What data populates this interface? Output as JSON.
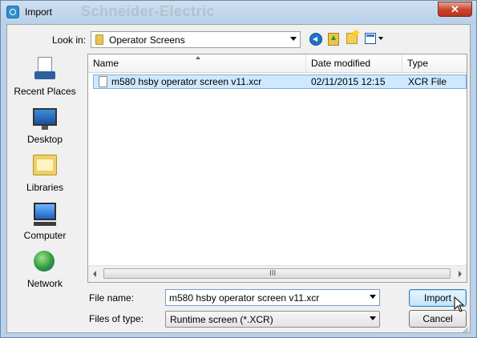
{
  "window": {
    "title": "Import",
    "watermark": "Schneider-Electric",
    "close_symbol": "✕"
  },
  "toolbar": {
    "look_in_label": "Look in:",
    "look_in_value": "Operator Screens",
    "icons": [
      "back-arrow-icon",
      "up-folder-icon",
      "new-folder-icon",
      "view-menu-icon"
    ]
  },
  "places": [
    {
      "label": "Recent Places",
      "icon": "recent-places-icon"
    },
    {
      "label": "Desktop",
      "icon": "desktop-icon"
    },
    {
      "label": "Libraries",
      "icon": "libraries-icon"
    },
    {
      "label": "Computer",
      "icon": "computer-icon"
    },
    {
      "label": "Network",
      "icon": "network-icon"
    }
  ],
  "file_list": {
    "columns": [
      "Name",
      "Date modified",
      "Type"
    ],
    "rows": [
      {
        "name": "m580 hsby operator screen v11.xcr",
        "date_modified": "02/11/2015 12:15",
        "type": "XCR File"
      }
    ],
    "scroll_grip": "III"
  },
  "form": {
    "file_name_label": "File name:",
    "file_name_value": "m580 hsby operator screen v11.xcr",
    "files_of_type_label": "Files of type:",
    "files_of_type_value": "Runtime screen  (*.XCR)"
  },
  "buttons": {
    "import": "Import",
    "cancel": "Cancel"
  }
}
